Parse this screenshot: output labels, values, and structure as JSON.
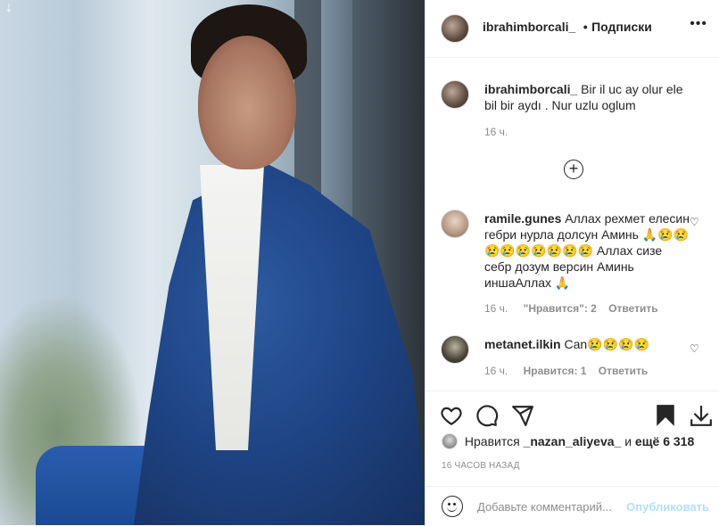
{
  "post": {
    "username": "ibrahimborcali_",
    "follow_separator": "•",
    "follow_label": "Подписки",
    "more_label": "•••",
    "caption_user": "ibrahimborcali_",
    "caption_text": "Bir il uc ay olur ele bil bir aydı . Nur uzlu oglum",
    "caption_time": "16 ч.",
    "load_more_label": "+"
  },
  "comments": [
    {
      "user": "ramile.gunes",
      "text": "Аллах рехмет елесин гебри нурла долсун Аминь 🙏😢😢😢😢😢😢😢😢😢 Аллах сизе себр дозум версин Аминь иншаАллах 🙏",
      "time": "16 ч.",
      "likes": "\"Нравится\": 2",
      "reply": "Ответить"
    },
    {
      "user": "metanet.ilkin",
      "text": "Can😢😢😢😢",
      "time": "16 ч.",
      "likes": "Нравится: 1",
      "reply": "Ответить"
    }
  ],
  "footer": {
    "likes_prefix": "Нравится",
    "likes_user": "_nazan_aliyeva_",
    "likes_middle": "и",
    "likes_more": "ещё 6 318",
    "timestamp": "16 ЧАСОВ НАЗАД",
    "comment_placeholder": "Добавьте комментарий...",
    "publish_label": "Опубликовать"
  },
  "icons": {
    "like": "heart-icon",
    "comment": "comment-icon",
    "share": "share-icon",
    "save": "bookmark-icon",
    "download": "download-icon",
    "emoji": "smiley-icon"
  },
  "colors": {
    "text": "#262626",
    "muted": "#8e8e8e",
    "publish_disabled": "#b2dffc",
    "border": "#efefef"
  }
}
